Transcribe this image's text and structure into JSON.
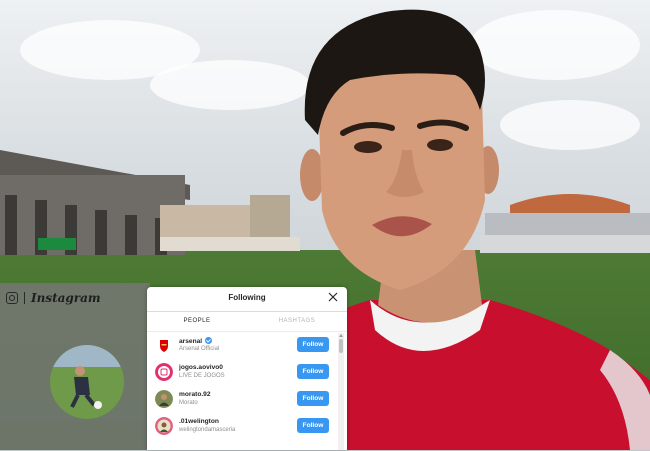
{
  "instagram": {
    "brand": "Instagram"
  },
  "dialog": {
    "title": "Following",
    "tabs": [
      {
        "label": "PEOPLE",
        "active": true
      },
      {
        "label": "HASHTAGS",
        "active": false
      }
    ],
    "rows": [
      {
        "username": "arsenal",
        "subtitle": "Arsenal Official",
        "verified": true,
        "button": "Follow",
        "avatar_icon": "arsenal-crest-icon"
      },
      {
        "username": "jogos.aovivo0",
        "subtitle": "LIVE DE JOGOS",
        "verified": false,
        "button": "Follow",
        "avatar_icon": "pink-logo-icon"
      },
      {
        "username": "morato.92",
        "subtitle": "Morato",
        "verified": false,
        "button": "Follow",
        "avatar_icon": "player-photo-icon"
      },
      {
        "username": ".01welington",
        "subtitle": "welingtondamasceria",
        "verified": false,
        "button": "Follow",
        "avatar_icon": "player-photo-icon"
      }
    ]
  },
  "colors": {
    "follow_button": "#3897f0",
    "shirt_red": "#c8102e"
  }
}
